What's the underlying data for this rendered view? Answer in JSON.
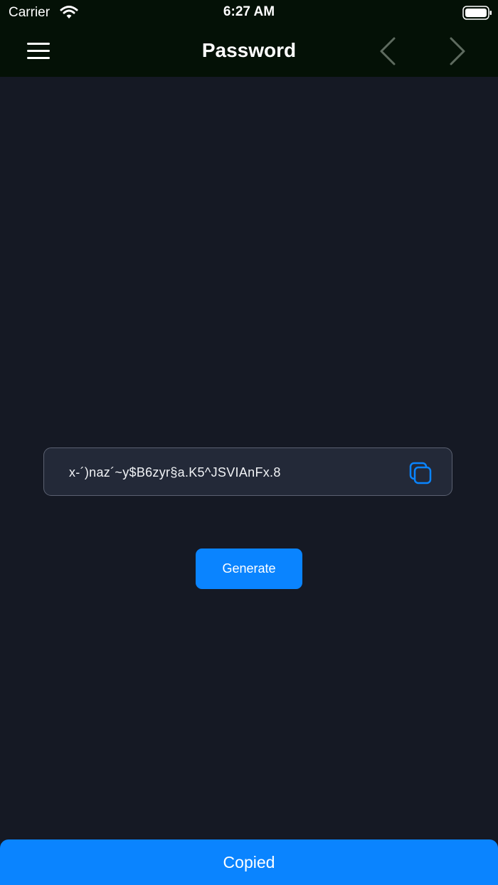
{
  "status_bar": {
    "carrier": "Carrier",
    "time": "6:27 AM",
    "wifi_icon": "wifi-icon",
    "battery_icon": "battery-icon"
  },
  "nav_bar": {
    "title": "Password",
    "menu_icon": "menu-icon",
    "back_icon": "chevron-left-icon",
    "forward_icon": "chevron-right-icon"
  },
  "password": {
    "value": "x-´)naz´~y$B6zyr§a.K5^JSVIAnFx.8",
    "copy_icon": "copy-icon"
  },
  "actions": {
    "generate_label": "Generate",
    "copied_label": "Copied"
  },
  "colors": {
    "background": "#151924",
    "header": "#041106",
    "accent": "#0a84ff",
    "field_background": "#232938",
    "field_border": "#5b6171"
  }
}
